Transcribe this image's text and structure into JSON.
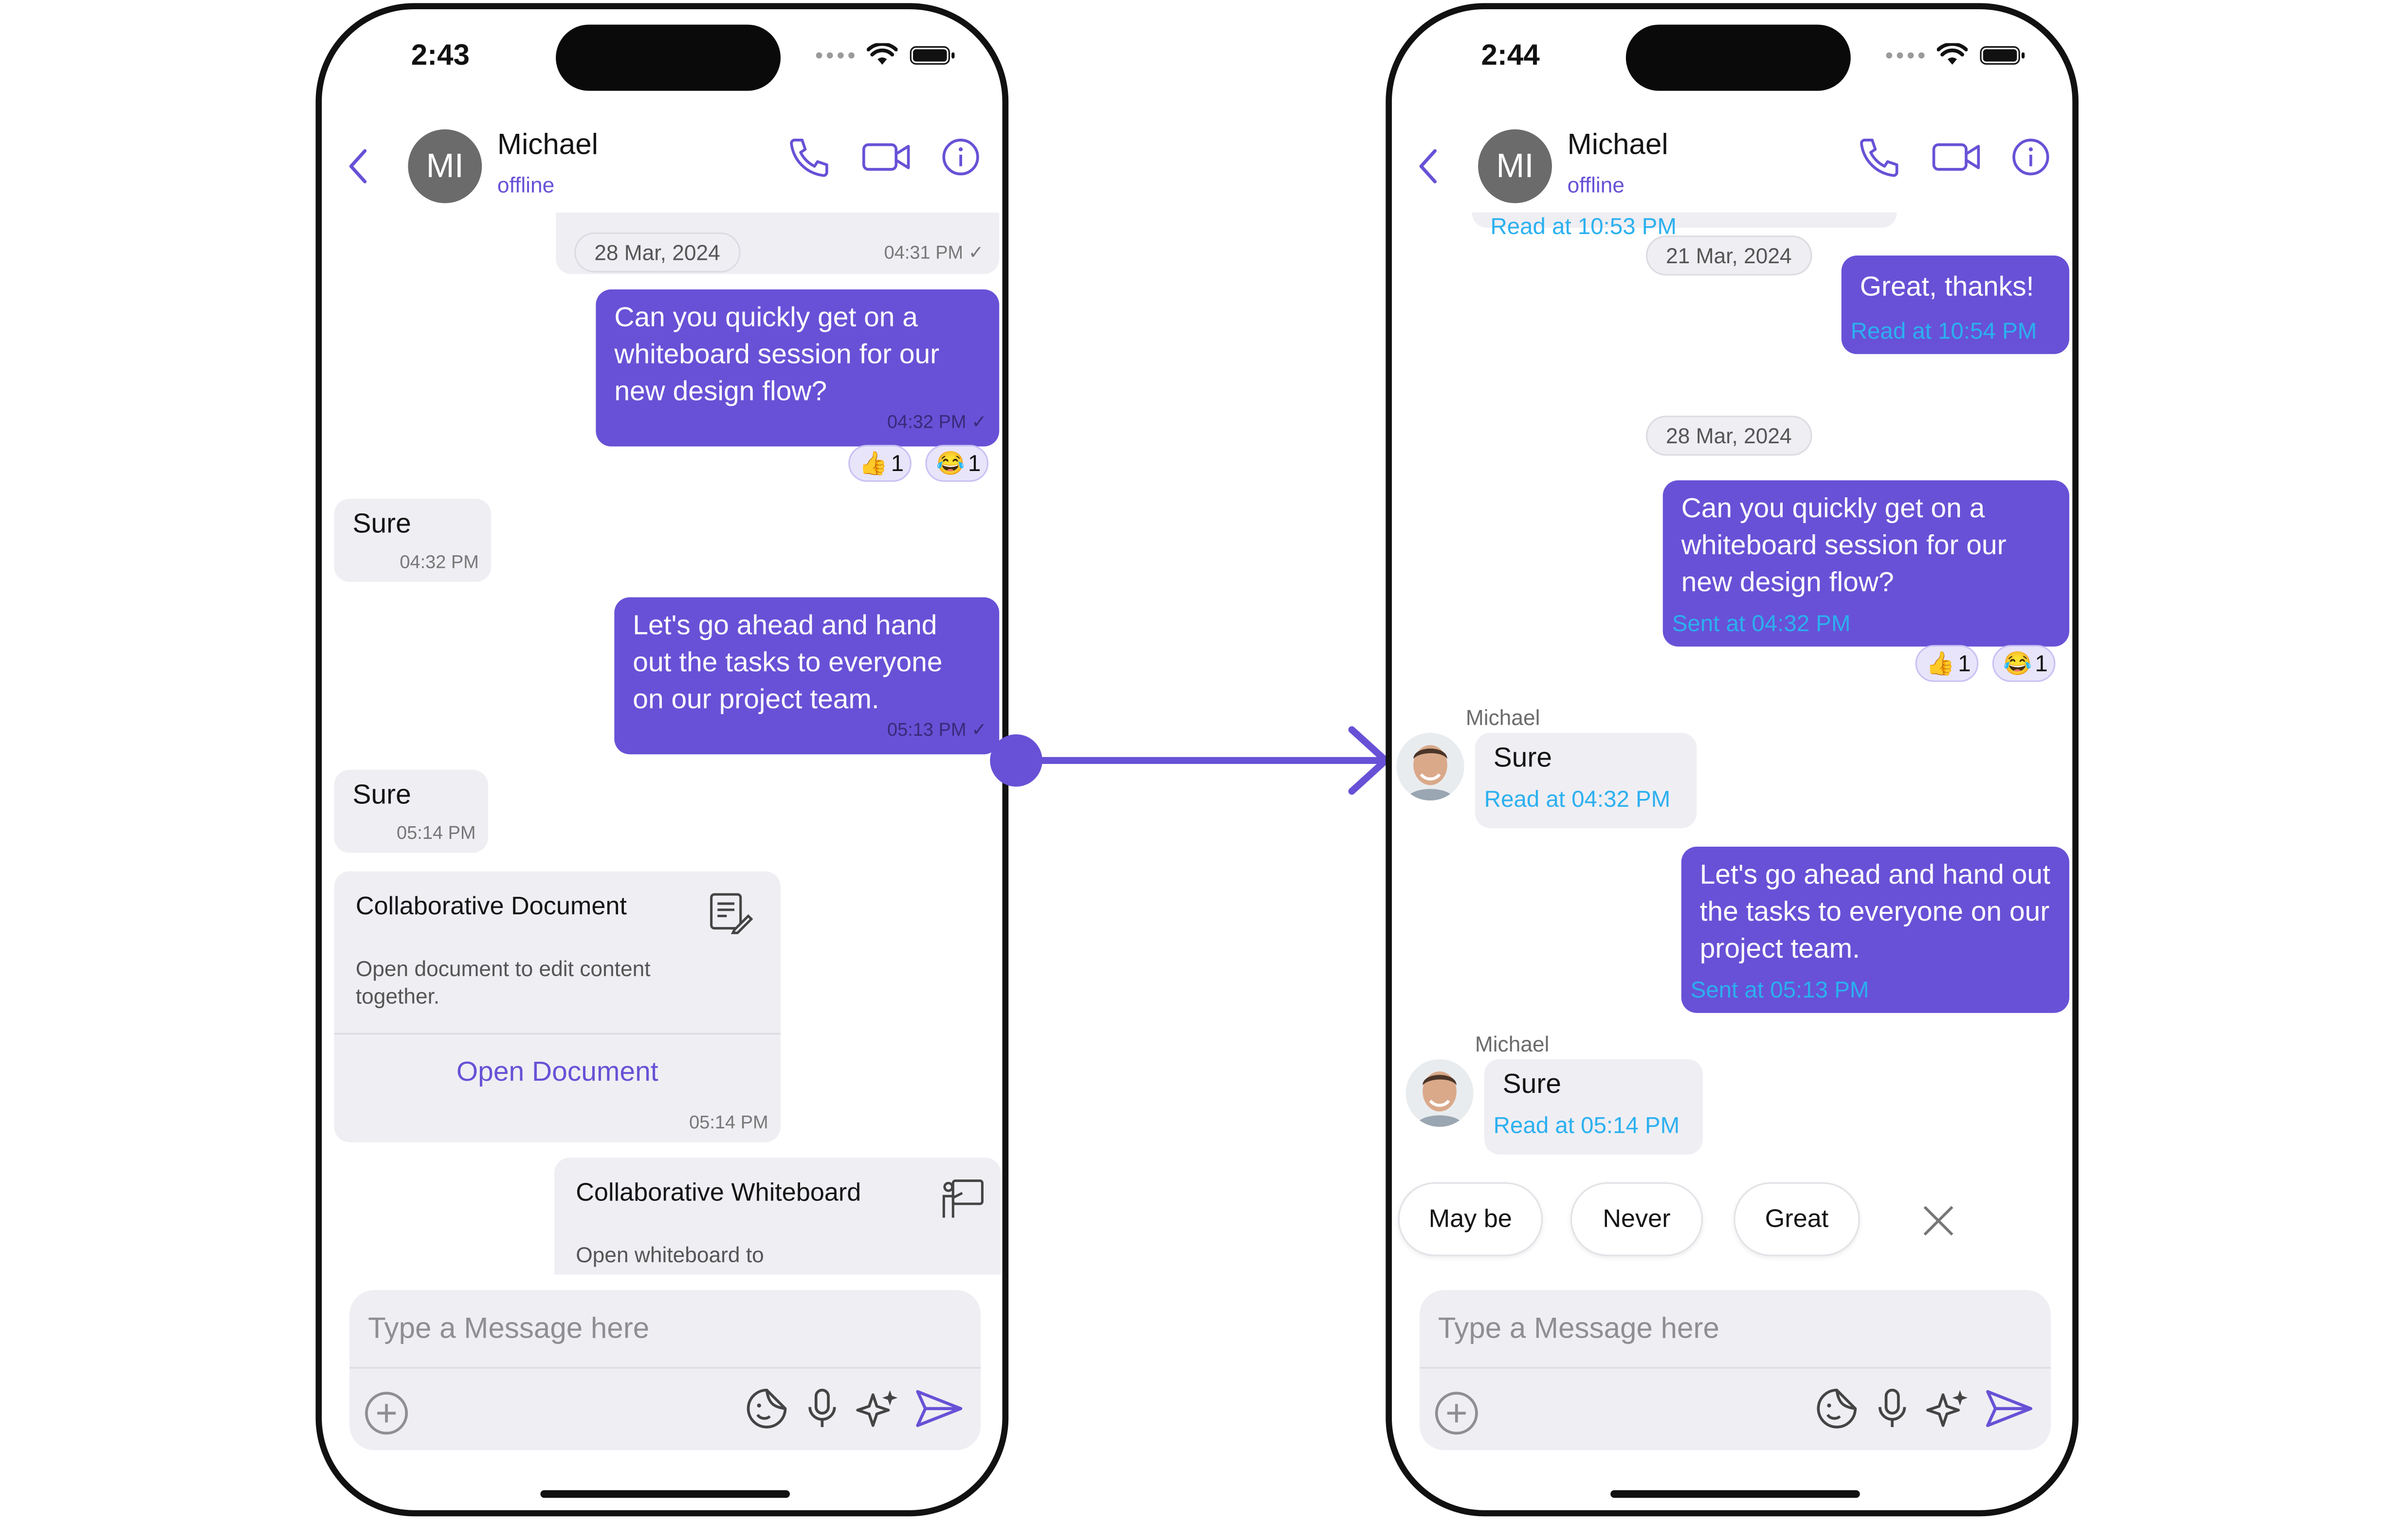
{
  "colors": {
    "accent": "#6851d6",
    "read_receipt": "#2bb0ef",
    "incoming_bg": "#efeef3"
  },
  "left": {
    "time": "2:43",
    "header": {
      "avatar_initials": "MI",
      "name": "Michael",
      "status": "offline"
    },
    "date_chip": "28 Mar, 2024",
    "top_meta": "04:31 PM",
    "msg1": {
      "text": "Can you quickly get on a whiteboard session for our new design flow?",
      "meta": "04:32 PM"
    },
    "reactions": [
      {
        "emoji": "👍",
        "count": "1"
      },
      {
        "emoji": "😂",
        "count": "1"
      }
    ],
    "in1": {
      "text": "Sure",
      "meta": "04:32 PM"
    },
    "msg2": {
      "text": "Let's go ahead and hand out the tasks to everyone on our project team.",
      "meta": "05:13 PM"
    },
    "in2": {
      "text": "Sure",
      "meta": "05:14 PM"
    },
    "doc_card": {
      "title": "Collaborative Document",
      "desc": "Open document to edit content together.",
      "link": "Open Document",
      "meta": "05:14 PM"
    },
    "wb_card": {
      "title": "Collaborative Whiteboard",
      "desc": "Open whiteboard to"
    },
    "composer": {
      "placeholder": "Type a Message here"
    }
  },
  "right": {
    "time": "2:44",
    "header": {
      "avatar_initials": "MI",
      "name": "Michael",
      "status": "offline"
    },
    "top_partial": "Read at 10:53 PM",
    "date_chip1": "21 Mar, 2024",
    "msg0": {
      "text": "Great, thanks!",
      "read": "Read at 10:54 PM"
    },
    "date_chip2": "28 Mar, 2024",
    "msg1": {
      "text": "Can you quickly get on a whiteboard session for our new design flow?",
      "read": "Sent at 04:32 PM"
    },
    "reactions": [
      {
        "emoji": "👍",
        "count": "1"
      },
      {
        "emoji": "😂",
        "count": "1"
      }
    ],
    "in1": {
      "sender": "Michael",
      "text": "Sure",
      "read": "Read at 04:32 PM"
    },
    "msg2": {
      "text": "Let's go ahead and hand out the tasks to everyone on our project team.",
      "read": "Sent at 05:13 PM"
    },
    "in2": {
      "sender": "Michael",
      "text": "Sure",
      "read": "Read at 05:14 PM"
    },
    "suggestions": [
      "May be",
      "Never",
      "Great"
    ],
    "composer": {
      "placeholder": "Type a Message here"
    }
  }
}
